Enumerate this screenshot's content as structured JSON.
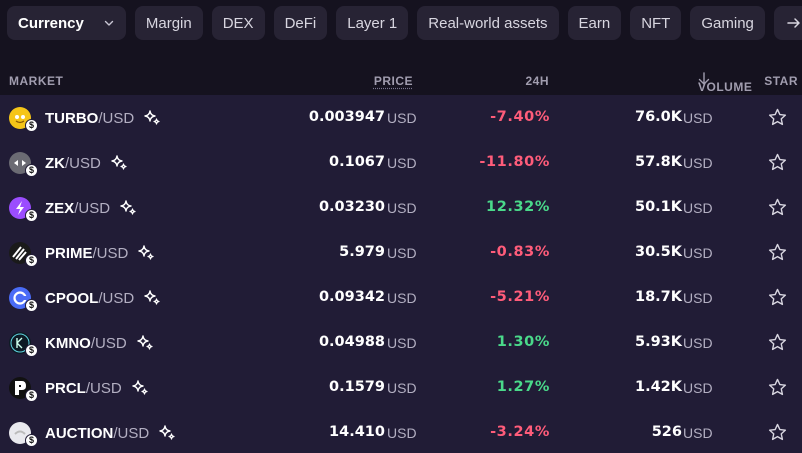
{
  "filters": {
    "selected": "Currency",
    "chips": [
      "Margin",
      "DEX",
      "DeFi",
      "Layer 1",
      "Real-world assets",
      "Earn",
      "NFT",
      "Gaming"
    ]
  },
  "table": {
    "headers": {
      "market": "MARKET",
      "price": "PRICE",
      "change": "24H",
      "volume": "VOLUME",
      "star": "STAR"
    },
    "rows": [
      {
        "base": "TURBO",
        "quote": "/USD",
        "price": "0.003947",
        "price_unit": "USD",
        "change": "-7.40%",
        "direction": "neg",
        "volume": "76.0K",
        "volume_unit": "USD",
        "icon": "turbo-coin-icon",
        "icon_color": "#f5c518"
      },
      {
        "base": "ZK",
        "quote": "/USD",
        "price": "0.1067",
        "price_unit": "USD",
        "change": "-11.80%",
        "direction": "neg",
        "volume": "57.8K",
        "volume_unit": "USD",
        "icon": "zk-coin-icon",
        "icon_color": "#6b6b73"
      },
      {
        "base": "ZEX",
        "quote": "/USD",
        "price": "0.03230",
        "price_unit": "USD",
        "change": "12.32%",
        "direction": "pos",
        "volume": "50.1K",
        "volume_unit": "USD",
        "icon": "zex-coin-icon",
        "icon_color": "#9b4dff"
      },
      {
        "base": "PRIME",
        "quote": "/USD",
        "price": "5.979",
        "price_unit": "USD",
        "change": "-0.83%",
        "direction": "neg",
        "volume": "30.5K",
        "volume_unit": "USD",
        "icon": "prime-coin-icon",
        "icon_color": "#1a1a1a"
      },
      {
        "base": "CPOOL",
        "quote": "/USD",
        "price": "0.09342",
        "price_unit": "USD",
        "change": "-5.21%",
        "direction": "neg",
        "volume": "18.7K",
        "volume_unit": "USD",
        "icon": "cpool-coin-icon",
        "icon_color": "#4a6cf7"
      },
      {
        "base": "KMNO",
        "quote": "/USD",
        "price": "0.04988",
        "price_unit": "USD",
        "change": "1.30%",
        "direction": "pos",
        "volume": "5.93K",
        "volume_unit": "USD",
        "icon": "kmno-coin-icon",
        "icon_color": "#0d1a24"
      },
      {
        "base": "PRCL",
        "quote": "/USD",
        "price": "0.1579",
        "price_unit": "USD",
        "change": "1.27%",
        "direction": "pos",
        "volume": "1.42K",
        "volume_unit": "USD",
        "icon": "prcl-coin-icon",
        "icon_color": "#111111"
      },
      {
        "base": "AUCTION",
        "quote": "/USD",
        "price": "14.410",
        "price_unit": "USD",
        "change": "-3.24%",
        "direction": "neg",
        "volume": "526",
        "volume_unit": "USD",
        "icon": "auction-coin-icon",
        "icon_color": "#e9e9ee"
      }
    ],
    "usd_badge": "$"
  },
  "colors": {
    "negative": "#ff5c7a",
    "positive": "#4ad98a",
    "background": "#15121f",
    "table_background": "#211c36"
  }
}
